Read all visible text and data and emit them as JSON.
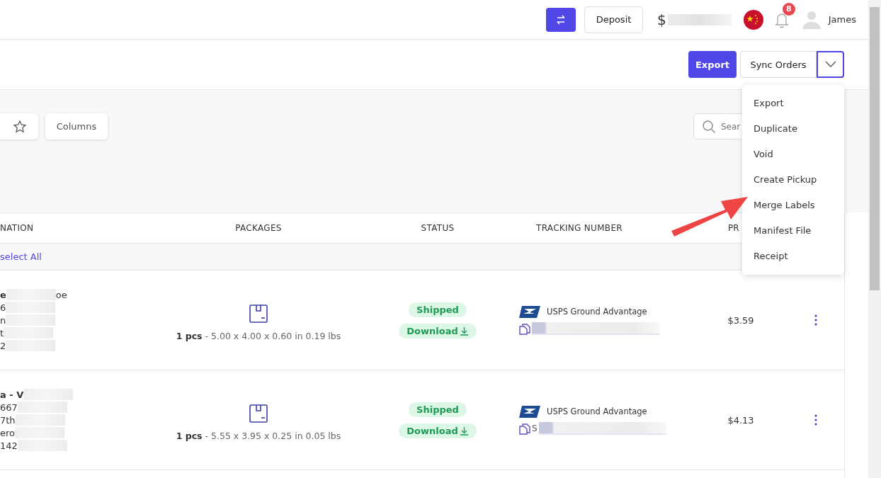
{
  "topbar": {
    "deposit": "Deposit",
    "balance_symbol": "$",
    "notifications": "8",
    "user": "James"
  },
  "actions": {
    "export": "Export",
    "sync": "Sync Orders",
    "menu_expanded": true
  },
  "menu": [
    {
      "label": "Export"
    },
    {
      "label": "Duplicate"
    },
    {
      "label": "Void"
    },
    {
      "label": "Create Pickup"
    },
    {
      "label": "Merge Labels"
    },
    {
      "label": "Manifest File"
    },
    {
      "label": "Receipt"
    }
  ],
  "filters": {
    "columns": "Columns",
    "search": {
      "placeholder": "Sear"
    }
  },
  "table": {
    "columns": [
      "NATION",
      "PACKAGES",
      "STATUS",
      "TRACKING NUMBER",
      "PR"
    ],
    "select_all": "select All",
    "rows": [
      {
        "destination": [
          {
            "text": "e",
            "tail": "oe"
          },
          {
            "text": "6"
          },
          {
            "text": "n"
          },
          {
            "text": "t"
          },
          {
            "text": "2"
          }
        ],
        "pieces": "1 pcs",
        "dims": " - 5.00 x 4.00 x 0.60 in  0.19 lbs",
        "status": "Shipped",
        "download": "Download",
        "carrier": "USPS Ground Advantage",
        "tracking": "",
        "price": "$3.59"
      },
      {
        "destination": [
          {
            "text": "a - V"
          },
          {
            "text": "667"
          },
          {
            "text": "7th"
          },
          {
            "text": "ero"
          },
          {
            "text": "142"
          }
        ],
        "pieces": "1 pcs",
        "dims": " - 5.55 x 3.95 x 0.25 in  0.05 lbs",
        "status": "Shipped",
        "download": "Download",
        "carrier": "USPS Ground Advantage",
        "tracking": "S",
        "price": "$4.13"
      }
    ]
  }
}
